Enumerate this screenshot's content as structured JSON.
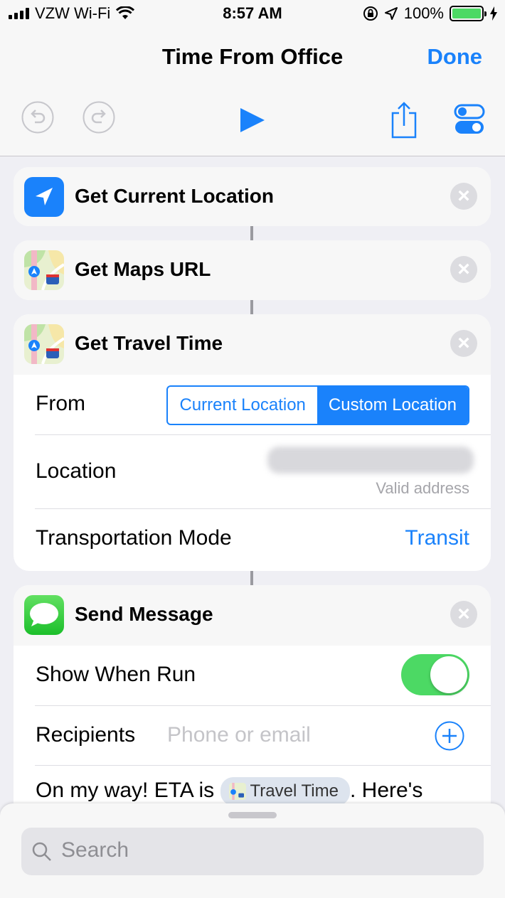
{
  "status_bar": {
    "carrier": "VZW Wi-Fi",
    "time": "8:57 AM",
    "battery": "100%"
  },
  "nav": {
    "title": "Time From Office",
    "done": "Done"
  },
  "actions": {
    "get_current_location": {
      "title": "Get Current Location"
    },
    "get_maps_url": {
      "title": "Get Maps URL"
    },
    "get_travel_time": {
      "title": "Get Travel Time",
      "from_label": "From",
      "from_options": [
        "Current Location",
        "Custom Location"
      ],
      "from_selected": "Custom Location",
      "location_label": "Location",
      "location_status": "Valid address",
      "mode_label": "Transportation Mode",
      "mode_value": "Transit"
    },
    "send_message": {
      "title": "Send Message",
      "show_when_run_label": "Show When Run",
      "show_when_run": true,
      "recipients_label": "Recipients",
      "recipients_placeholder": "Phone or email",
      "message_prefix": "On my way! ETA is",
      "message_token": "Travel Time",
      "message_suffix": ". Here's"
    }
  },
  "bottom_sheet": {
    "search_placeholder": "Search"
  },
  "colors": {
    "accent": "#1a82fb",
    "toggle_on": "#4cd964",
    "background": "#efeff4"
  }
}
